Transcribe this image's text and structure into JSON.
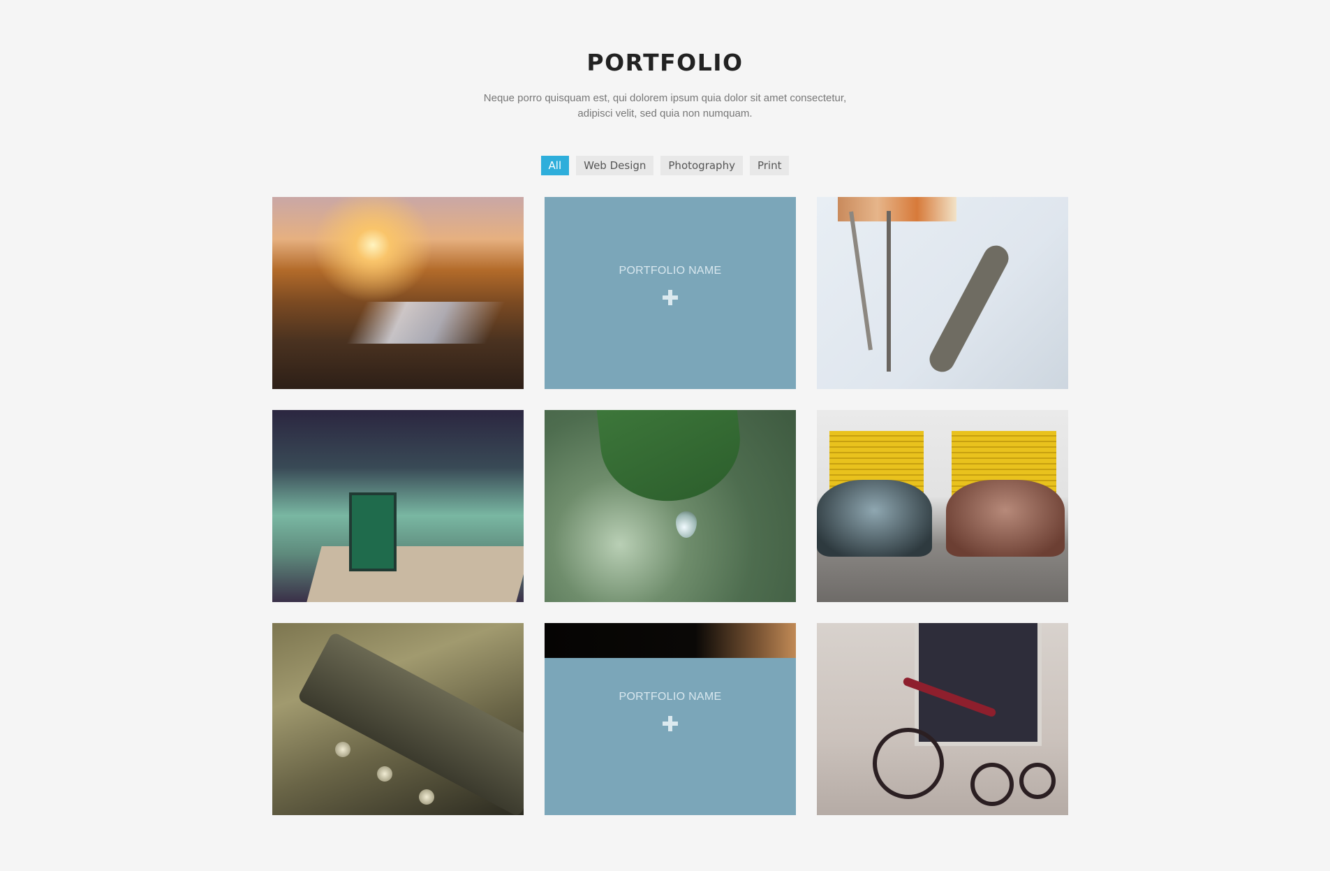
{
  "header": {
    "title": "PORTFOLIO",
    "subtitle": "Neque porro quisquam est, qui dolorem ipsum quia dolor sit amet consectetur, adipisci velit, sed quia non numquam."
  },
  "filters": [
    {
      "label": "All",
      "active": true
    },
    {
      "label": "Web Design",
      "active": false
    },
    {
      "label": "Photography",
      "active": false
    },
    {
      "label": "Print",
      "active": false
    }
  ],
  "accent_color": "#2eaedb",
  "overlay_color": "#7ba6b9",
  "portfolio": {
    "items": [
      {
        "photo": "sunset-field",
        "overlay": false
      },
      {
        "photo": "hidden",
        "overlay": true,
        "overlay_name": "PORTFOLIO NAME",
        "icon": "plus-icon"
      },
      {
        "photo": "skateboard",
        "overlay": false
      },
      {
        "photo": "cafe-chalkboard",
        "overlay": false
      },
      {
        "photo": "leaf-water-drop",
        "overlay": false
      },
      {
        "photo": "vintage-cars",
        "overlay": false
      },
      {
        "photo": "guitar-headstock",
        "overlay": false
      },
      {
        "photo": "partially-hidden",
        "overlay": true,
        "overlay_name": "PORTFOLIO NAME",
        "icon": "plus-icon"
      },
      {
        "photo": "red-tricycle",
        "overlay": false
      }
    ]
  }
}
